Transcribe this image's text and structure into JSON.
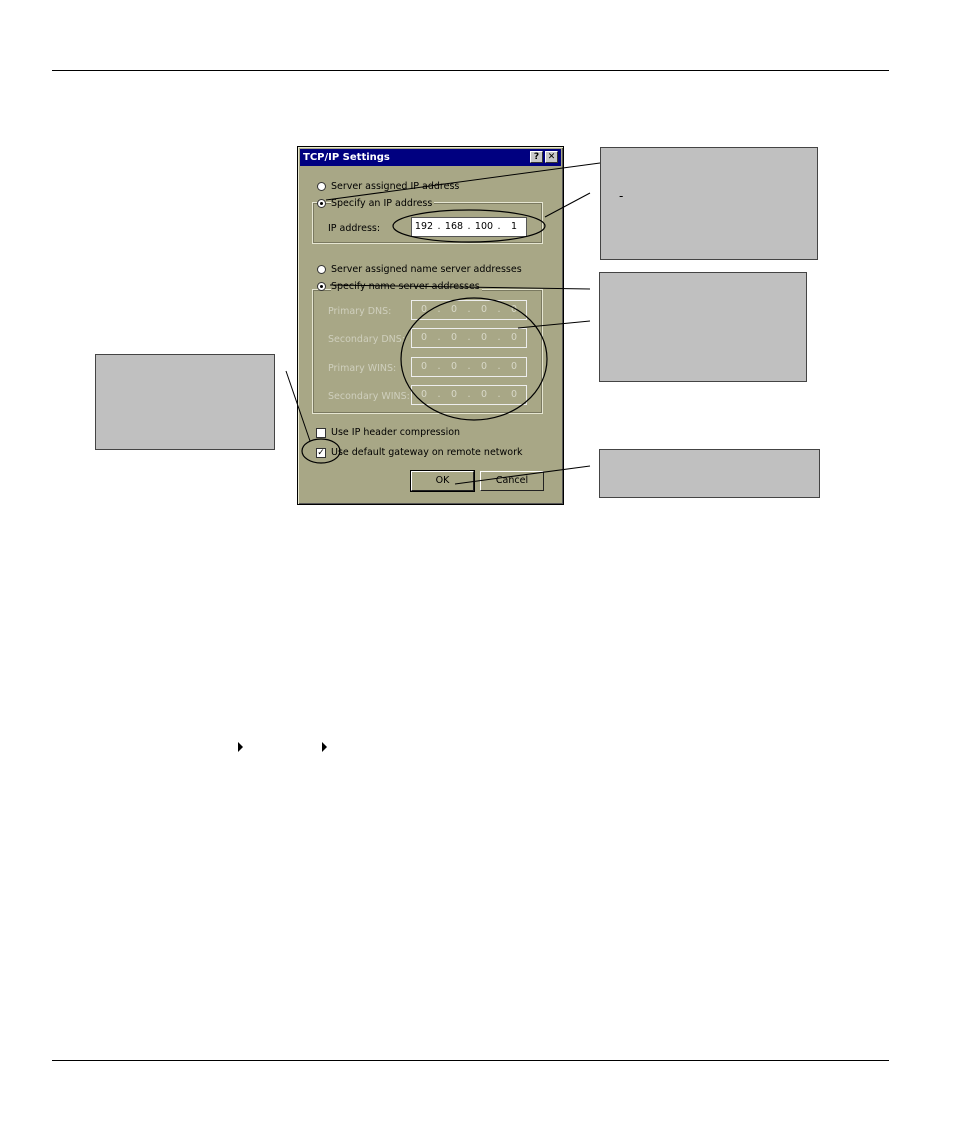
{
  "dialog": {
    "title": "TCP/IP Settings",
    "help_button": "?",
    "close_button": "✕",
    "ip_options": {
      "server_assigned": "Server assigned IP address",
      "specify": "Specify an IP address",
      "selected": "specify"
    },
    "ip_address": {
      "label": "IP address:",
      "octets": [
        "192",
        "168",
        "100",
        "1"
      ]
    },
    "dns_options": {
      "server_assigned": "Server assigned name server addresses",
      "specify": "Specify name server addresses",
      "selected": "specify"
    },
    "dns_fields": [
      {
        "label": "Primary DNS:",
        "octets": [
          "0",
          "0",
          "0",
          "0"
        ]
      },
      {
        "label": "Secondary DNS:",
        "octets": [
          "0",
          "0",
          "0",
          "0"
        ]
      },
      {
        "label": "Primary WINS:",
        "octets": [
          "0",
          "0",
          "0",
          "0"
        ]
      },
      {
        "label": "Secondary WINS:",
        "octets": [
          "0",
          "0",
          "0",
          "0"
        ]
      }
    ],
    "checkboxes": {
      "ip_header_compression": {
        "label": "Use IP header compression",
        "checked": false
      },
      "default_gateway": {
        "label": "Use default gateway on remote network",
        "checked": true
      }
    },
    "buttons": {
      "ok": "OK",
      "cancel": "Cancel"
    }
  },
  "callouts": {
    "top_right_mark": "-"
  },
  "colors": {
    "dialog_face": "#a8a786",
    "title_bar": "#000080",
    "callout_fill": "#c0c0c0"
  }
}
